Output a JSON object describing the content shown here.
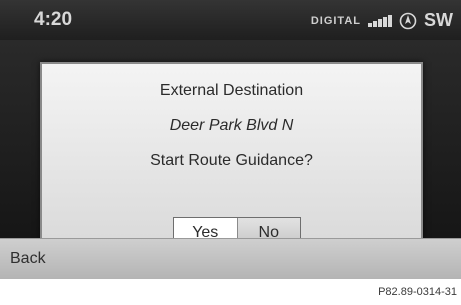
{
  "status_bar": {
    "time": "4:20",
    "radio_label": "DIGITAL",
    "signal_level": "5 of 5 bars",
    "compass_icon": "compass-icon",
    "heading": "SW"
  },
  "dialog": {
    "title": "External Destination",
    "destination": "Deer Park Blvd N",
    "question": "Start Route Guidance?",
    "buttons": {
      "yes": "Yes",
      "no": "No",
      "selected": "Yes"
    }
  },
  "footer": {
    "back_label": "Back"
  },
  "reference_code": "P82.89-0314-31",
  "colors": {
    "dialog_background": "#e6e6e6",
    "screen_background": "#1f1f1f",
    "selected_button": "#ffffff"
  }
}
